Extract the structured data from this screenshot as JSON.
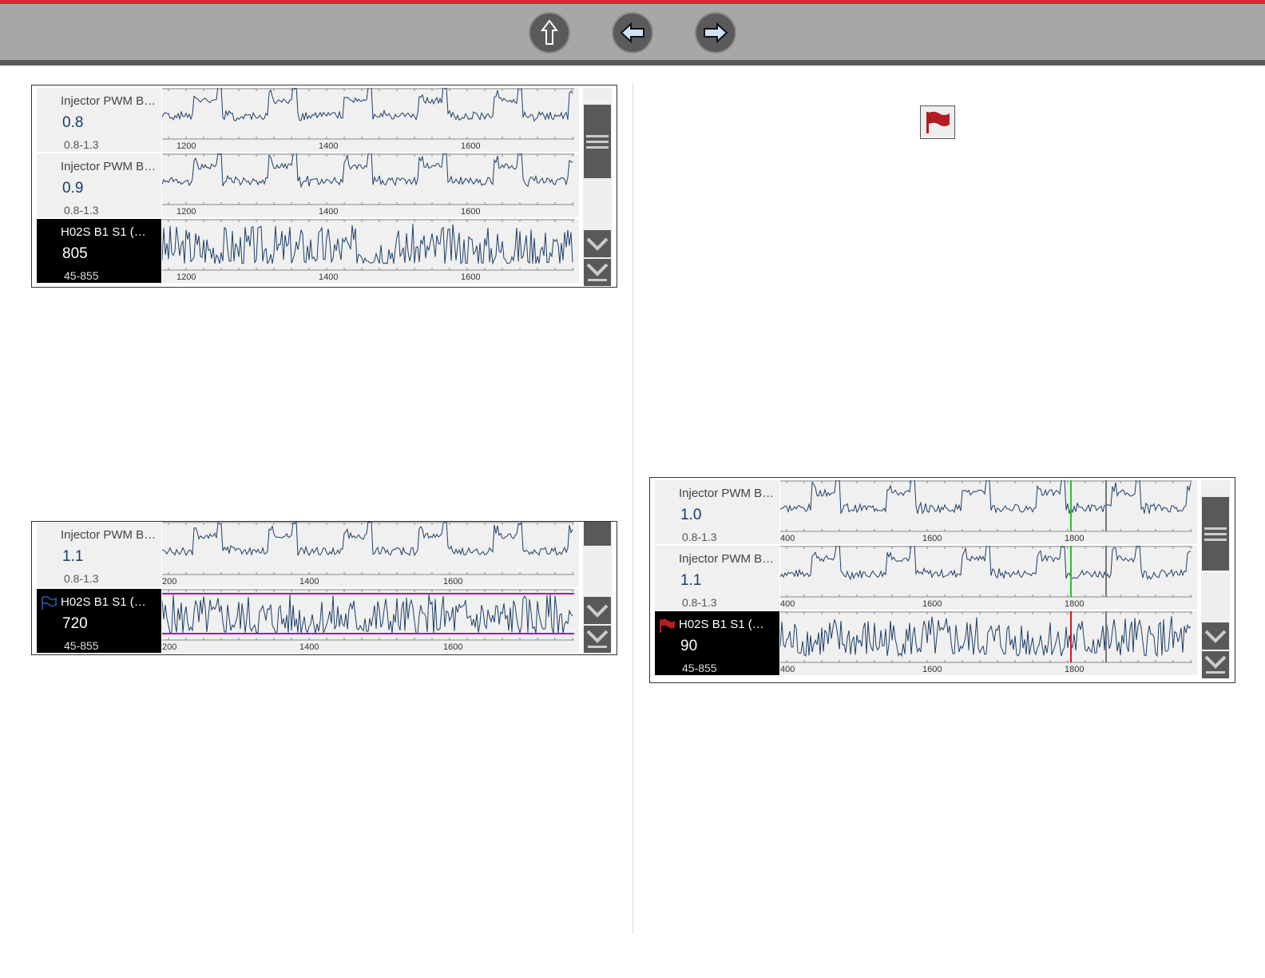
{
  "nav": {
    "up_label": "Up",
    "back_label": "Back",
    "forward_label": "Forward"
  },
  "colors": {
    "brand_red": "#d8262e",
    "trace": "#1f3f66",
    "limit_line": "#a020a0",
    "cursor_green": "#33bb33",
    "cursor_red": "#dd1122",
    "flag": "#b01e24"
  },
  "panel1": {
    "rows": [
      {
        "name": "Injector PWM B…",
        "value": "0.8",
        "range": "0.8-1.3",
        "ticks": [
          "1200",
          "1400",
          "1600"
        ]
      },
      {
        "name": "Injector PWM B…",
        "value": "0.9",
        "range": "0.8-1.3",
        "ticks": [
          "1200",
          "1400",
          "1600"
        ]
      },
      {
        "name": "H02S B1 S1 (…",
        "value": "805",
        "range": "45-855",
        "ticks": [
          "1200",
          "1400",
          "1600"
        ]
      }
    ]
  },
  "panel2": {
    "rows": [
      {
        "name": "Injector PWM B…",
        "value": "1.1",
        "range": "0.8-1.3",
        "ticks": [
          "200",
          "1400",
          "1600"
        ]
      },
      {
        "name": "H02S B1 S1 (…",
        "value": "720",
        "range": "45-855",
        "ticks": [
          "200",
          "1400",
          "1600"
        ]
      }
    ]
  },
  "panel3": {
    "rows": [
      {
        "name": "Injector PWM B…",
        "value": "1.0",
        "range": "0.8-1.3",
        "ticks": [
          "400",
          "1600",
          "1800"
        ]
      },
      {
        "name": "Injector PWM B…",
        "value": "1.1",
        "range": "0.8-1.3",
        "ticks": [
          "400",
          "1600",
          "1800"
        ]
      },
      {
        "name": "H02S B1 S1 (…",
        "value": "90",
        "range": "45-855",
        "ticks": [
          "400",
          "1600",
          "1800"
        ]
      }
    ]
  },
  "flag_icon": "flag-icon"
}
